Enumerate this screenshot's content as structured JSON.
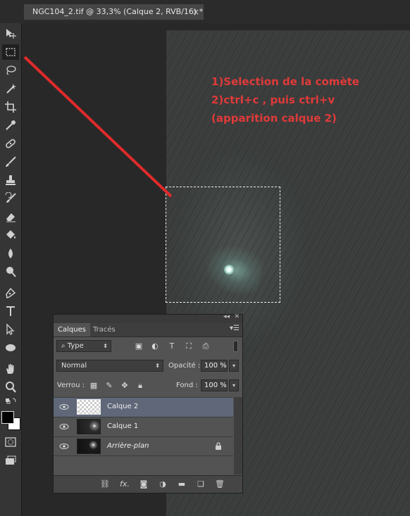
{
  "document_tab": {
    "title": "NGC104_2.tif @ 33,3% (Calque 2, RVB/16) *",
    "close_glyph": "×"
  },
  "toolbar": {
    "tools": [
      "move-tool",
      "marquee-tool",
      "lasso-tool",
      "magic-wand-tool",
      "crop-tool",
      "eyedropper-tool",
      "healing-brush-tool",
      "brush-tool",
      "clone-stamp-tool",
      "history-brush-tool",
      "eraser-tool",
      "paint-bucket-tool",
      "blur-tool",
      "dodge-tool",
      "pen-tool",
      "type-tool",
      "path-selection-tool",
      "ellipse-tool",
      "hand-tool",
      "zoom-tool"
    ],
    "active_tool": "marquee-tool"
  },
  "annotation": {
    "line1": "1)Selection de la comète",
    "line2": "2)ctrl+c , puis ctrl+v",
    "line3": "(apparition calque 2)",
    "color": "#e03a3a"
  },
  "layers_panel": {
    "tabs": [
      "Calques",
      "Tracés"
    ],
    "active_tab": "Calques",
    "filter_kind": "Type",
    "blend_mode": "Normal",
    "opacity_label": "Opacité :",
    "opacity_value": "100 %",
    "lock_label": "Verrou :",
    "fill_label": "Fond :",
    "fill_value": "100 %",
    "layers": [
      {
        "name": "Calque 2",
        "selected": true,
        "visible": true
      },
      {
        "name": "Calque 1",
        "selected": false,
        "visible": true
      },
      {
        "name": "Arrière-plan",
        "selected": false,
        "visible": true,
        "locked": true
      }
    ],
    "fx_label": "fx."
  },
  "colors": {
    "selected_layer": "#5f6778",
    "panel_bg": "#535353",
    "annotation_red": "#e03a3a"
  }
}
